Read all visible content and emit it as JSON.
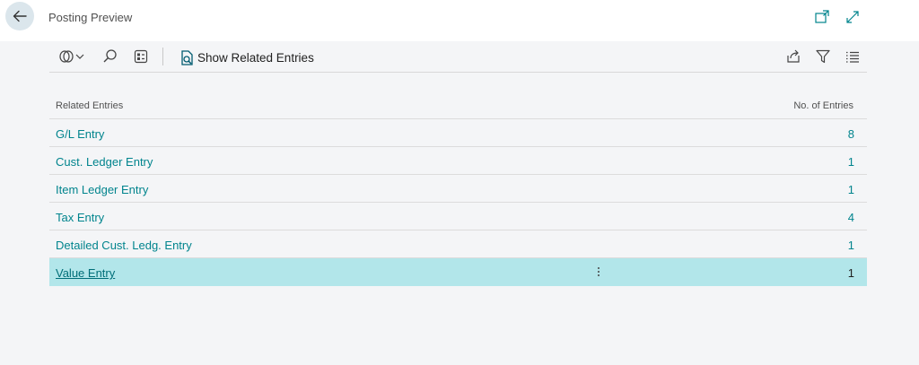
{
  "header": {
    "title": "Posting Preview"
  },
  "toolbar": {
    "show_related_entries_label": "Show Related Entries"
  },
  "list": {
    "columns": {
      "related_entries": "Related Entries",
      "no_of_entries": "No. of Entries"
    },
    "rows": [
      {
        "name": "G/L Entry",
        "count": "8"
      },
      {
        "name": "Cust. Ledger Entry",
        "count": "1"
      },
      {
        "name": "Item Ledger Entry",
        "count": "1"
      },
      {
        "name": "Tax Entry",
        "count": "4"
      },
      {
        "name": "Detailed Cust. Ledg. Entry",
        "count": "1"
      },
      {
        "name": "Value Entry",
        "count": "1",
        "selected": true
      }
    ]
  },
  "colors": {
    "accent": "#00848d",
    "selected_row": "#b2e6ea",
    "background": "#f4f5f7"
  }
}
